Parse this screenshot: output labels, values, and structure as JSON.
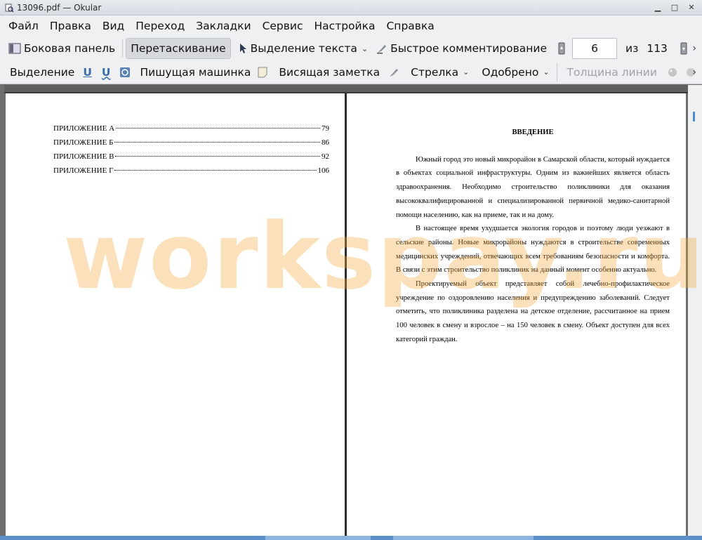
{
  "window": {
    "title": "13096.pdf  — Okular"
  },
  "menu": [
    "Файл",
    "Правка",
    "Вид",
    "Переход",
    "Закладки",
    "Сервис",
    "Настройка",
    "Справка"
  ],
  "toolbar1": {
    "sidebar": "Боковая панель",
    "drag": "Перетаскивание",
    "text_select": "Выделение текста",
    "quick_comment": "Быстрое комментирование",
    "page_value": "6",
    "of_label": "из",
    "total_pages": "113"
  },
  "toolbar2": {
    "selection": "Выделение",
    "typewriter": "Пишущая машинка",
    "note": "Висящая заметка",
    "arrow": "Стрелка",
    "stamp": "Одобрено",
    "line_width": "Толщина линии"
  },
  "toc": [
    {
      "label": "ПРИЛОЖЕНИЕ А",
      "page": "79"
    },
    {
      "label": "ПРИЛОЖЕНИЕ Б",
      "page": "86"
    },
    {
      "label": "ПРИЛОЖЕНИЕ В",
      "page": "92"
    },
    {
      "label": "ПРИЛОЖЕНИЕ Г",
      "page": "106"
    }
  ],
  "intro": {
    "heading": "ВВЕДЕНИЕ",
    "p1": "Южный город это новый микрорайон в Самарской области, который нуждается в объектах социальной инфраструктуры. Одним из важнейших является область здравоохранения. Необходимо строительство поликлиники для оказания высококвалифицированной и специализированной первичной медико-санитарной помощи населению, как на приеме, так и на дому.",
    "p2": "В настоящее время ухудшается экология городов и поэтому люди уезжают в сельские районы. Новые микрорайоны нуждаются в строительстве современных медицинских учреждений, отвечающих всем требованиям безопасности и комфорта. В связи с этим строительство поликлиник на данный момент особенно актуально.",
    "p3": "Проектируемый объект представляет собой лечебно-профилактическое учреждение по оздоровлению населения и предупреждению заболеваний. Следует отметить, что поликлиника разделена на детское отделение, рассчитанное на прием 100 человек в смену и взрослое – на 150 человек в смену. Объект доступен для всех категорий граждан."
  },
  "watermark": "workspay.ru"
}
